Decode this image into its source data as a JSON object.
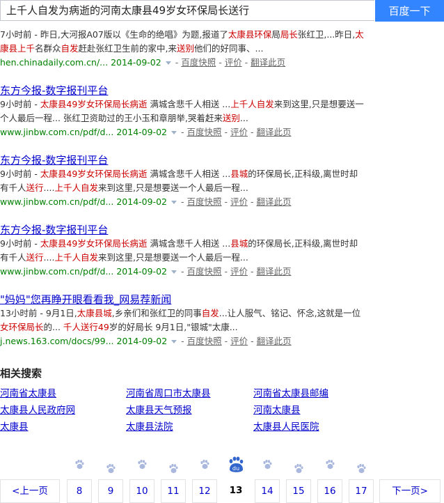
{
  "search": {
    "query": "上千人自发为病逝的河南太康县49岁女环保局长送行",
    "button_label": "百度一下"
  },
  "results": [
    {
      "title": "",
      "abstract_lines": [
        [
          [
            "7小时前 - 昨日,大河报A07版以《生命的绝唱》为题,报道了",
            false
          ],
          [
            "太康县环保",
            true
          ],
          [
            "局",
            false
          ],
          [
            "局长",
            true
          ],
          [
            "张红卫,...昨日,",
            false
          ],
          [
            "太",
            true
          ]
        ],
        [
          [
            "康县上千",
            true
          ],
          [
            "名群众",
            false
          ],
          [
            "自发",
            true
          ],
          [
            "赶赴张红卫生前的家中,来",
            false
          ],
          [
            "送别",
            true
          ],
          [
            "他们的好同事、...",
            false
          ]
        ]
      ],
      "url": "hen.chinadaily.com.cn/...",
      "date": "2014-09-02",
      "cache_label": "百度快照",
      "rate_label": "评价",
      "translate_label": "翻译此页"
    },
    {
      "title": "东方今报-数字报刊平台",
      "abstract_lines": [
        [
          [
            "9小时前 - ",
            false
          ],
          [
            "太康县49岁女环保局长病逝",
            true
          ],
          [
            " 满城含悲千人相送 ...",
            false
          ],
          [
            "上千人自发",
            true
          ],
          [
            "来到这里,只是想要送一",
            false
          ]
        ],
        [
          [
            "个人最后一程...",
            false
          ],
          [
            " 张红卫资助过的王小玉和章朋举,哭着赶来",
            false
          ],
          [
            "送别",
            true
          ],
          [
            "...",
            false
          ]
        ]
      ],
      "url": "www.jinbw.com.cn/pdf/d...",
      "date": "2014-09-02",
      "cache_label": "百度快照",
      "rate_label": "评价",
      "translate_label": "翻译此页"
    },
    {
      "title": "东方今报-数字报刊平台",
      "abstract_lines": [
        [
          [
            "9小时前 - ",
            false
          ],
          [
            "太康县49岁女环保局长病逝",
            true
          ],
          [
            " 满城含悲千人相送 ...",
            false
          ],
          [
            "县城",
            true
          ],
          [
            "的环保局长,正科级,离世时却",
            false
          ]
        ],
        [
          [
            "有千人",
            false
          ],
          [
            "送行",
            true
          ],
          [
            "....",
            false
          ],
          [
            "上千人自发",
            true
          ],
          [
            "来到这里,只是想要送一个人最后一程...",
            false
          ]
        ]
      ],
      "url": "www.jinbw.com.cn/pdf/d...",
      "date": "2014-09-02",
      "cache_label": "百度快照",
      "rate_label": "评价",
      "translate_label": "翻译此页"
    },
    {
      "title": "东方今报-数字报刊平台",
      "abstract_lines": [
        [
          [
            "9小时前 - ",
            false
          ],
          [
            "太康县49岁女环保局长病逝",
            true
          ],
          [
            " 满城含悲千人相送 ...",
            false
          ],
          [
            "县城",
            true
          ],
          [
            "的环保局长,正科级,离世时却",
            false
          ]
        ],
        [
          [
            "有千人",
            false
          ],
          [
            "送行",
            true
          ],
          [
            "....",
            false
          ],
          [
            "上千人自发",
            true
          ],
          [
            "来到这里,只是想要送一个人最后一程...",
            false
          ]
        ]
      ],
      "url": "www.jinbw.com.cn/pdf/d...",
      "date": "2014-09-02",
      "cache_label": "百度快照",
      "rate_label": "评价",
      "translate_label": "翻译此页"
    },
    {
      "title": "\"妈妈\"您再睁开眼看看我_网易荐新闻",
      "abstract_lines": [
        [
          [
            "13小时前 - 9月1日,",
            false
          ],
          [
            "太康县城",
            true
          ],
          [
            ",乡亲们和张红卫的同事",
            false
          ],
          [
            "自发",
            true
          ],
          [
            "...让人服气、铭记、怀念,这就是一位",
            false
          ]
        ],
        [
          [
            "女环保局长",
            true
          ],
          [
            "的... ",
            false
          ],
          [
            "千人送行49",
            true
          ],
          [
            "岁",
            false
          ],
          [
            "的好局长 9月1日,\"银城\"太康...",
            false
          ]
        ]
      ],
      "url": "j.news.163.com/docs/99...",
      "date": "2014-09-02",
      "cache_label": "百度快照",
      "rate_label": "评价",
      "translate_label": "翻译此页"
    }
  ],
  "related": {
    "title": "相关搜索",
    "items": [
      "河南省太康县",
      "河南省周口市太康县",
      "河南省太康县邮编",
      "太康县人民政府网",
      "太康县天气预报",
      "河南太康县",
      "太康县",
      "太康县法院",
      "太康县人民医院"
    ]
  },
  "pagination": {
    "prev_label": "<上一页",
    "next_label": "下一页>",
    "pages": [
      "8",
      "9",
      "10",
      "11",
      "12",
      "13",
      "14",
      "15",
      "16",
      "17"
    ],
    "current": "13",
    "current_badge": "du"
  },
  "colors": {
    "highlight": "#cc0000",
    "link": "#0000cc",
    "url": "#008000",
    "button": "#3385ff",
    "paw_light": "#aab8dd",
    "paw_active": "#3366cc"
  }
}
